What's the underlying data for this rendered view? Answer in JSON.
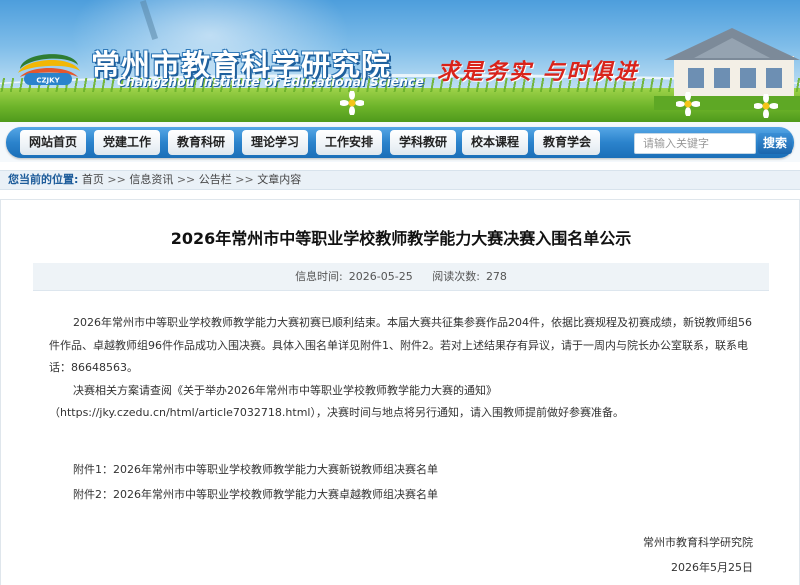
{
  "header": {
    "org_cn": "常州市教育科学研究院",
    "org_en": "Changzhou Institute of Educational Science",
    "logo_text": "CZJKY",
    "slogan": "求是务实 与时俱进"
  },
  "nav": {
    "items": [
      {
        "label": "网站首页"
      },
      {
        "label": "党建工作"
      },
      {
        "label": "教育科研"
      },
      {
        "label": "理论学习"
      },
      {
        "label": "工作安排"
      },
      {
        "label": "学科教研"
      },
      {
        "label": "校本课程"
      },
      {
        "label": "教育学会"
      }
    ],
    "search_placeholder": "请输入关键字",
    "search_button": "搜索"
  },
  "breadcrumb": {
    "label": "您当前的位置:",
    "items": [
      "首页",
      "信息资讯",
      "公告栏",
      "文章内容"
    ],
    "sep": " >>"
  },
  "article": {
    "title": "2026年常州市中等职业学校教师教学能力大赛决赛入围名单公示",
    "info_time_label": "信息时间:",
    "info_time": "2026-05-25",
    "views_label": "阅读次数:",
    "views": "278",
    "para1": "2026年常州市中等职业学校教师教学能力大赛初赛已顺利结束。本届大赛共征集参赛作品204件，依据比赛规程及初赛成绩，新锐教师组56件作品、卓越教师组96件作品成功入围决赛。具体入围名单详见附件1、附件2。若对上述结果存有异议，请于一周内与院长办公室联系，联系电话：86648563。",
    "para2": "决赛相关方案请查阅《关于举办2026年常州市中等职业学校教师教学能力大赛的通知》（https://jky.czedu.cn/html/article7032718.html），决赛时间与地点将另行通知，请入围教师提前做好参赛准备。",
    "attachment1": "附件1：2026年常州市中等职业学校教师教学能力大赛新锐教师组决赛名单",
    "attachment2": "附件2：2026年常州市中等职业学校教师教学能力大赛卓越教师组决赛名单",
    "sign_org": "常州市教育科学研究院",
    "sign_date": "2026年5月25日"
  },
  "colors": {
    "nav_blue": "#2b83cc",
    "slogan_red": "#d9231b",
    "crumb_blue": "#1d5c9a"
  }
}
